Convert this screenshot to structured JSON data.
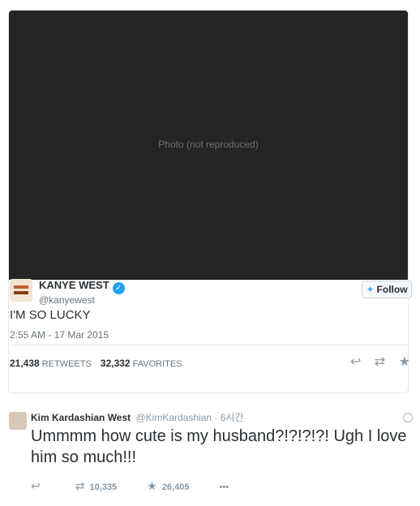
{
  "tweet": {
    "media_note": "Photo (not reproduced)",
    "author_name": "KANYE WEST",
    "handle": "@kanyewest",
    "follow_label": "Follow",
    "text": "I'M SO LUCKY",
    "timestamp": "2:55 AM - 17 Mar 2015",
    "retweets_count": "21,438",
    "retweets_label": "RETWEETS",
    "favorites_count": "32,332",
    "favorites_label": "FAVORITES"
  },
  "reply": {
    "author_name": "Kim Kardashian West",
    "handle": "@KimKardashian",
    "time": "· 6시간",
    "text": "Ummmm how cute is my husband?!?!?!?! Ugh I love him so much!!!",
    "retweet_count": "10,335",
    "favorite_count": "26,405",
    "more": "•••"
  },
  "icons": {
    "reply": "↩",
    "retweet": "⇄",
    "favorite": "★",
    "verified": "✓",
    "bird": "🐦"
  },
  "colors": {
    "accent": "#1da1f2",
    "muted": "#8899a6"
  }
}
